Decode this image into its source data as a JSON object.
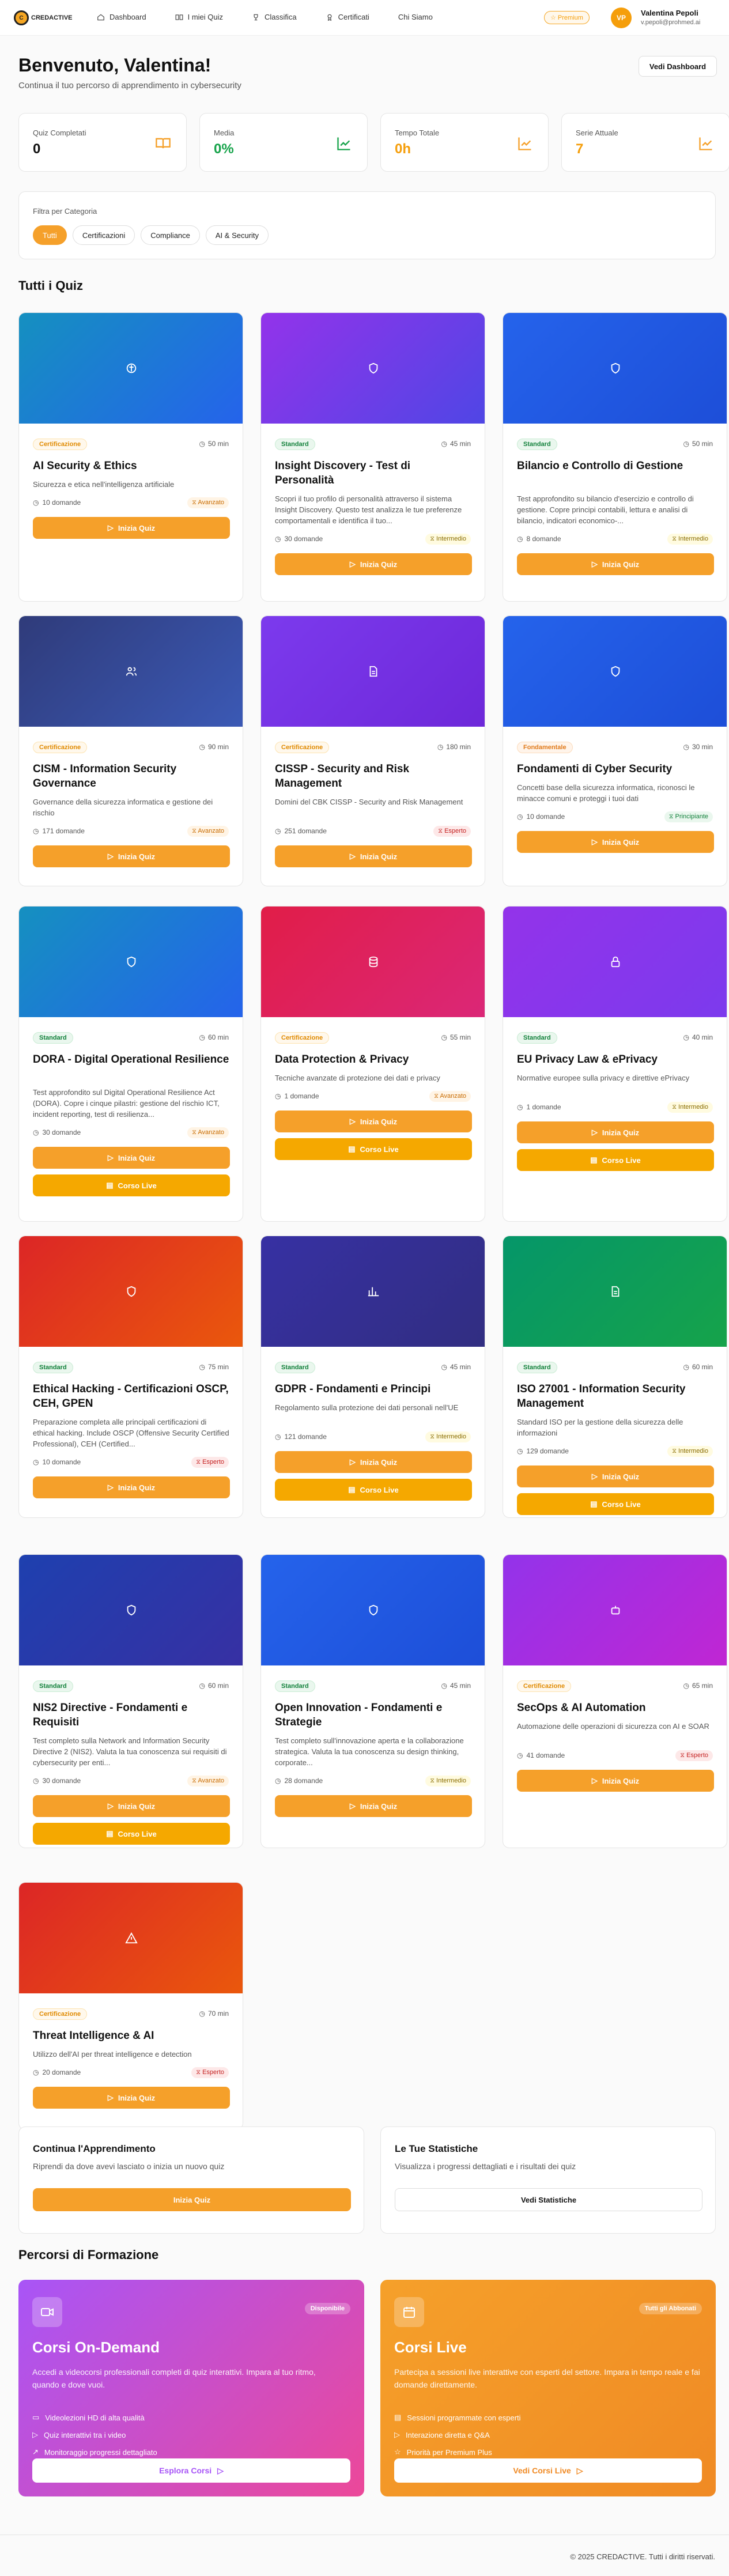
{
  "nav": {
    "logo_text": "CREDACTIVE",
    "links": [
      "Dashboard",
      "I miei Quiz",
      "Classifica",
      "Certificati",
      "Chi Siamo"
    ],
    "premium": "Premium",
    "avatar": "VP",
    "user_name": "Valentina Pepoli",
    "user_email": "v.pepoli@prohmed.ai"
  },
  "header": {
    "title": "Benvenuto, Valentina!",
    "subtitle": "Continua il tuo percorso di apprendimento in cybersecurity",
    "dashboard_button": "Vedi Dashboard"
  },
  "stats": [
    {
      "label": "Quiz Completati",
      "value": "0",
      "color": "#111111",
      "icon": "book-icon"
    },
    {
      "label": "Media",
      "value": "0%",
      "color": "#16a34a",
      "icon": "chart-icon"
    },
    {
      "label": "Tempo Totale",
      "value": "0h",
      "color": "#f59e0b",
      "icon": "chart-icon"
    },
    {
      "label": "Serie Attuale",
      "value": "7",
      "color": "#f59e0b",
      "icon": "chart-icon"
    }
  ],
  "filter": {
    "label": "Filtra per Categoria",
    "chips": [
      "Tutti",
      "Certificazioni",
      "Compliance",
      "AI & Security"
    ]
  },
  "quizzes_title": "Tutti i Quiz",
  "quizzes": [
    {
      "category": "Certificazione",
      "duration": "50 min",
      "title": "AI Security & Ethics",
      "desc": "Sicurezza e etica nell'intelligenza artificiale",
      "questions": "10 domande",
      "level": "Avanzato",
      "start": "Inizia Quiz",
      "live": ""
    },
    {
      "category": "Standard",
      "duration": "45 min",
      "title": "Insight Discovery - Test di Personalità",
      "desc": "Scopri il tuo profilo di personalità attraverso il sistema Insight Discovery. Questo test analizza le tue preferenze comportamentali e identifica il tuo...",
      "questions": "30 domande",
      "level": "Intermedio",
      "start": "Inizia Quiz",
      "live": ""
    },
    {
      "category": "Standard",
      "duration": "50 min",
      "title": "Bilancio e Controllo di Gestione",
      "desc": "Test approfondito su bilancio d'esercizio e controllo di gestione. Copre principi contabili, lettura e analisi di bilancio, indicatori economico-...",
      "questions": "8 domande",
      "level": "Intermedio",
      "start": "Inizia Quiz",
      "live": ""
    },
    {
      "category": "Certificazione",
      "duration": "90 min",
      "title": "CISM - Information Security Governance",
      "desc": "Governance della sicurezza informatica e gestione dei rischio",
      "questions": "171 domande",
      "level": "Avanzato",
      "start": "Inizia Quiz",
      "live": ""
    },
    {
      "category": "Certificazione",
      "duration": "180 min",
      "title": "CISSP - Security and Risk Management",
      "desc": "Domini del CBK CISSP - Security and Risk Management",
      "questions": "251 domande",
      "level": "Esperto",
      "start": "Inizia Quiz",
      "live": ""
    },
    {
      "category": "Fondamentale",
      "duration": "30 min",
      "title": "Fondamenti di Cyber Security",
      "desc": "Concetti base della sicurezza informatica, riconosci le minacce comuni e proteggi i tuoi dati",
      "questions": "10 domande",
      "level": "Principiante",
      "start": "Inizia Quiz",
      "live": ""
    },
    {
      "category": "Standard",
      "duration": "60 min",
      "title": "DORA - Digital Operational Resilience",
      "desc": "Test approfondito sul Digital Operational Resilience Act (DORA). Copre i cinque pilastri: gestione del rischio ICT, incident reporting, test di resilienza...",
      "questions": "30 domande",
      "level": "Avanzato",
      "start": "Inizia Quiz",
      "live": "Corso Live"
    },
    {
      "category": "Certificazione",
      "duration": "55 min",
      "title": "Data Protection & Privacy",
      "desc": "Tecniche avanzate di protezione dei dati e privacy",
      "questions": "1 domande",
      "level": "Avanzato",
      "start": "Inizia Quiz",
      "live": "Corso Live"
    },
    {
      "category": "Standard",
      "duration": "40 min",
      "title": "EU Privacy Law & ePrivacy",
      "desc": "Normative europee sulla privacy e direttive ePrivacy",
      "questions": "1 domande",
      "level": "Intermedio",
      "start": "Inizia Quiz",
      "live": "Corso Live"
    },
    {
      "category": "Standard",
      "duration": "75 min",
      "title": "Ethical Hacking - Certificazioni OSCP, CEH, GPEN",
      "desc": "Preparazione completa alle principali certificazioni di ethical hacking. Include OSCP (Offensive Security Certified Professional), CEH (Certified...",
      "questions": "10 domande",
      "level": "Esperto",
      "start": "Inizia Quiz",
      "live": ""
    },
    {
      "category": "Standard",
      "duration": "45 min",
      "title": "GDPR - Fondamenti e Principi",
      "desc": "Regolamento sulla protezione dei dati personali nell'UE",
      "questions": "121 domande",
      "level": "Intermedio",
      "start": "Inizia Quiz",
      "live": "Corso Live"
    },
    {
      "category": "Standard",
      "duration": "60 min",
      "title": "ISO 27001 - Information Security Management",
      "desc": "Standard ISO per la gestione della sicurezza delle informazioni",
      "questions": "129 domande",
      "level": "Intermedio",
      "start": "Inizia Quiz",
      "live": "Corso Live"
    },
    {
      "category": "Standard",
      "duration": "60 min",
      "title": "NIS2 Directive - Fondamenti e Requisiti",
      "desc": "Test completo sulla Network and Information Security Directive 2 (NIS2). Valuta la tua conoscenza sui requisiti di cybersecurity per enti...",
      "questions": "30 domande",
      "level": "Avanzato",
      "start": "Inizia Quiz",
      "live": "Corso Live"
    },
    {
      "category": "Standard",
      "duration": "45 min",
      "title": "Open Innovation - Fondamenti e Strategie",
      "desc": "Test completo sull'innovazione aperta e la collaborazione strategica. Valuta la tua conoscenza su design thinking, corporate...",
      "questions": "28 domande",
      "level": "Intermedio",
      "start": "Inizia Quiz",
      "live": ""
    },
    {
      "category": "Certificazione",
      "duration": "65 min",
      "title": "SecOps & AI Automation",
      "desc": "Automazione delle operazioni di sicurezza con AI e SOAR",
      "questions": "41 domande",
      "level": "Esperto",
      "start": "Inizia Quiz",
      "live": ""
    },
    {
      "category": "Certificazione",
      "duration": "70 min",
      "title": "Threat Intelligence & AI",
      "desc": "Utilizzo dell'AI per threat intelligence e detection",
      "questions": "20 domande",
      "level": "Esperto",
      "start": "Inizia Quiz",
      "live": ""
    }
  ],
  "continue": {
    "title": "Continua l'Apprendimento",
    "subtitle": "Riprendi da dove avevi lasciato o inizia un nuovo quiz",
    "button": "Inizia Quiz"
  },
  "stats_card": {
    "title": "Le Tue Statistiche",
    "subtitle": "Visualizza i progressi dettagliati e i risultati dei quiz",
    "button": "Vedi Statistiche"
  },
  "paths_title": "Percorsi di Formazione",
  "paths": [
    {
      "badge": "Disponibile",
      "title": "Corsi On-Demand",
      "desc": "Accedi a videocorsi professionali completi di quiz interattivi. Impara al tuo ritmo, quando e dove vuoi.",
      "features": [
        "Videolezioni HD di alta qualità",
        "Quiz interattivi tra i video",
        "Monitoraggio progressi dettagliato"
      ],
      "button": "Esplora Corsi"
    },
    {
      "badge": "Tutti gli Abbonati",
      "title": "Corsi Live",
      "desc": "Partecipa a sessioni live interattive con esperti del settore. Impara in tempo reale e fai domande direttamente.",
      "features": [
        "Sessioni programmate con esperti",
        "Interazione diretta e Q&A",
        "Priorità per Premium Plus"
      ],
      "button": "Vedi Corsi Live"
    }
  ],
  "footer": "© 2025 CREDACTIVE. Tutti i diritti riservati."
}
